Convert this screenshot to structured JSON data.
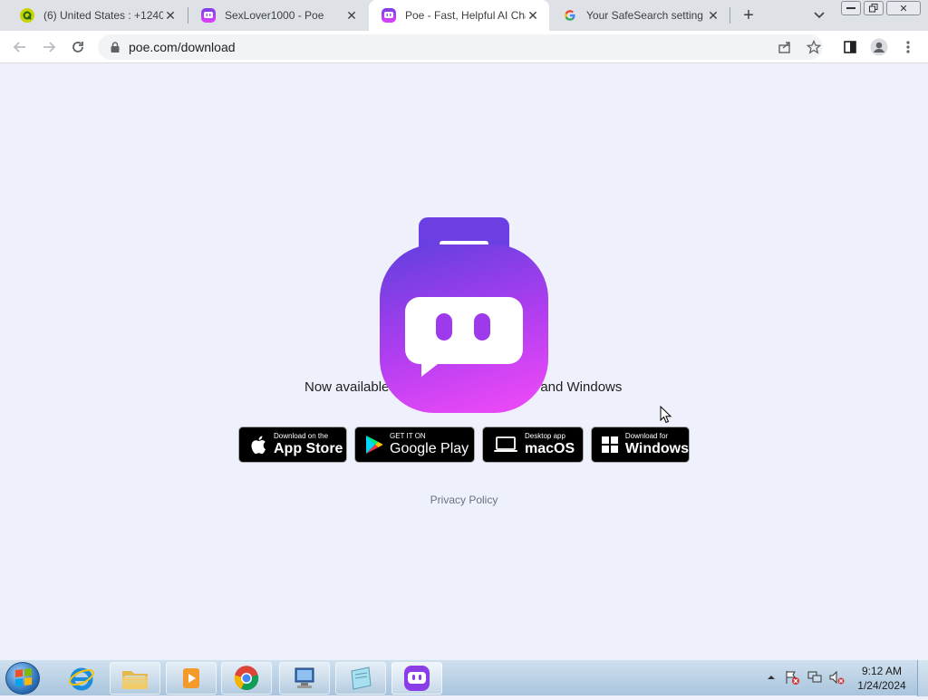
{
  "tabs": [
    {
      "title": "(6) United States : +1240",
      "favicon": "quora-icon"
    },
    {
      "title": "SexLover1000 - Poe",
      "favicon": "poe-icon"
    },
    {
      "title": "Poe - Fast, Helpful AI Cha",
      "favicon": "poe-icon",
      "active": true
    },
    {
      "title": "Your SafeSearch setting",
      "favicon": "google-icon"
    }
  ],
  "address_bar": {
    "url": "poe.com/download"
  },
  "page": {
    "availability_left": "Now available",
    "availability_right": ", and Windows",
    "stores": [
      {
        "small": "Download on the",
        "big": "App Store",
        "icon": "apple-icon"
      },
      {
        "small": "GET IT ON",
        "big": "Google Play",
        "icon": "google-play-icon"
      },
      {
        "small": "Desktop app",
        "big": "macOS",
        "icon": "laptop-icon"
      },
      {
        "small": "Download for",
        "big": "Windows",
        "icon": "windows-icon"
      }
    ],
    "privacy_policy": "Privacy Policy"
  },
  "taskbar": {
    "time": "9:12 AM",
    "date": "1/24/2024"
  },
  "colors": {
    "page_bg": "#eef0fb",
    "poe_gradient_top": "#7b3fe4",
    "poe_gradient_bottom": "#e040fb"
  }
}
